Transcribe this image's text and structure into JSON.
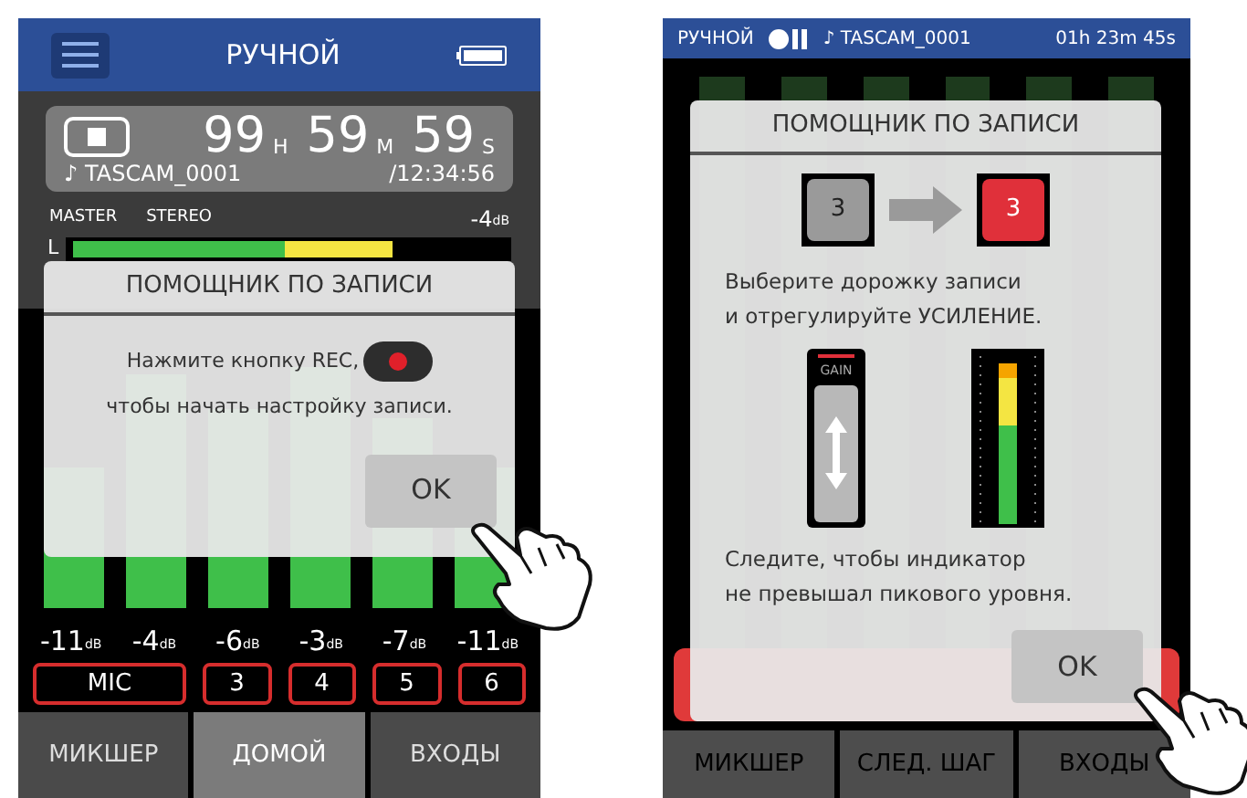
{
  "home_screen": {
    "header": {
      "title": "РУЧНОЙ"
    },
    "timer": {
      "hours": "99",
      "hours_unit": "H",
      "minutes": "59",
      "minutes_unit": "M",
      "seconds": "59",
      "seconds_unit": "S",
      "file": "♪ TASCAM_0001",
      "total": "/12:34:56"
    },
    "master": {
      "label": "MASTER",
      "mode": "STEREO",
      "reading": "-4",
      "unit": "dB",
      "channel": "L",
      "level": 0.74
    },
    "dialog": {
      "title": "ПОМОЩНИК ПО ЗАПИСИ",
      "line_1": "Нажмите кнопку REC,",
      "line_2": "чтобы начать настройку записи.",
      "ok": "OK"
    },
    "meters": [
      {
        "reading": "-11",
        "unit": "dB",
        "level": 0.48
      },
      {
        "reading": "-4",
        "unit": "dB",
        "level": 0.8
      },
      {
        "reading": "-6",
        "unit": "dB",
        "level": 0.68
      },
      {
        "reading": "-3",
        "unit": "dB",
        "level": 0.82
      },
      {
        "reading": "-7",
        "unit": "dB",
        "level": 0.65
      },
      {
        "reading": "-11",
        "unit": "dB",
        "level": 0.48
      }
    ],
    "inputs": [
      {
        "name": "MIC",
        "kind": "stereo"
      },
      {
        "name": "3",
        "kind": "mono"
      },
      {
        "name": "4",
        "kind": "mono"
      },
      {
        "name": "5",
        "kind": "mono"
      },
      {
        "name": "6",
        "kind": "mono"
      }
    ],
    "tabs": [
      {
        "label": "МИКШЕР",
        "selected": false
      },
      {
        "label": "ДОМОЙ",
        "selected": true
      },
      {
        "label": "ВХОДЫ",
        "selected": false
      }
    ]
  },
  "step_screen": {
    "status": {
      "mode": "РУЧНОЙ",
      "file": "♪ TASCAM_0001",
      "elapsed": "01h 23m 45s"
    },
    "dialog": {
      "title": "ПОМОЩНИК ПО ЗАПИСИ",
      "track_from": "3",
      "track_to": "3",
      "line_1": "Выберите дорожку записи",
      "line_2": "и отрегулируйте УСИЛЕНИЕ.",
      "gain_label": "GAIN",
      "line_3": "Следите, чтобы индикатор",
      "line_4": "не превышал пикового уровня.",
      "ok": "OK"
    },
    "tabs": [
      {
        "label": "МИКШЕР",
        "selected": false
      },
      {
        "label": "СЛЕД. ШАГ",
        "selected": false
      },
      {
        "label": "ВХОДЫ",
        "selected": false
      }
    ]
  }
}
